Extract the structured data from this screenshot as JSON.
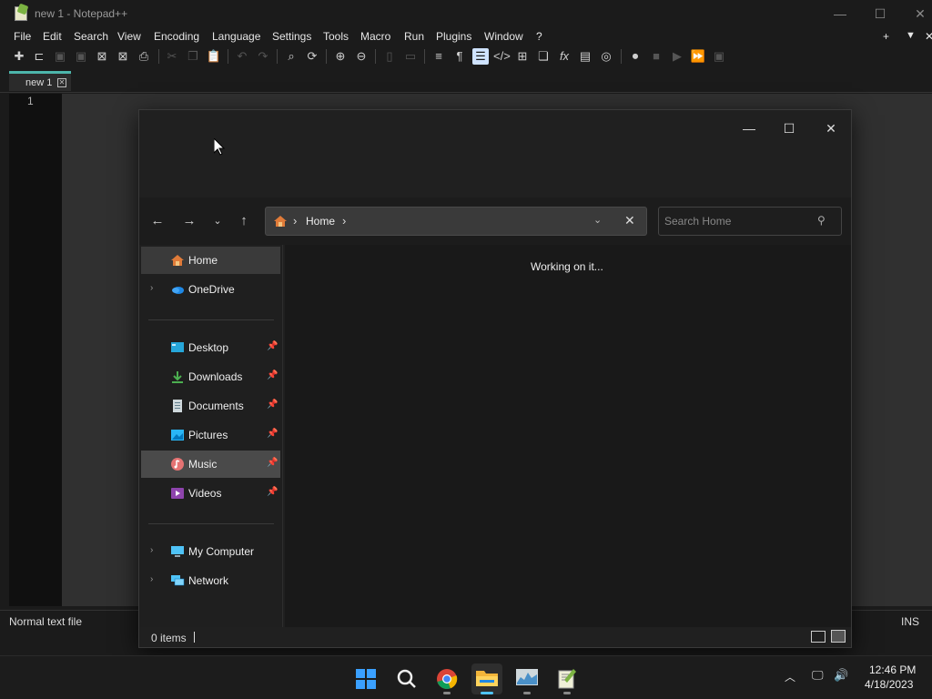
{
  "npp": {
    "title": "new 1 - Notepad++",
    "menu": [
      "File",
      "Edit",
      "Search",
      "View",
      "Encoding",
      "Language",
      "Settings",
      "Tools",
      "Macro",
      "Run",
      "Plugins",
      "Window",
      "?"
    ],
    "menu_right": [
      "+",
      "▼",
      "✕"
    ],
    "tab_label": "new 1",
    "line_number": "1",
    "status_left": "Normal text file",
    "status_right": "INS"
  },
  "explorer": {
    "address": {
      "crumb": "Home"
    },
    "search": {
      "placeholder": "Search Home"
    },
    "nav": [
      {
        "label": "Home",
        "icon": "home-icon"
      },
      {
        "label": "OneDrive",
        "icon": "onedrive-icon"
      },
      {
        "label": "Desktop",
        "icon": "desktop-icon"
      },
      {
        "label": "Downloads",
        "icon": "downloads-icon"
      },
      {
        "label": "Documents",
        "icon": "documents-icon"
      },
      {
        "label": "Pictures",
        "icon": "pictures-icon"
      },
      {
        "label": "Music",
        "icon": "music-icon"
      },
      {
        "label": "Videos",
        "icon": "videos-icon"
      },
      {
        "label": "My Computer",
        "icon": "computer-icon"
      },
      {
        "label": "Network",
        "icon": "network-icon"
      }
    ],
    "main_status": "Working on it...",
    "items_count": "0 items"
  },
  "taskbar": {
    "clock_time": "12:46 PM",
    "clock_date": "4/18/2023"
  }
}
